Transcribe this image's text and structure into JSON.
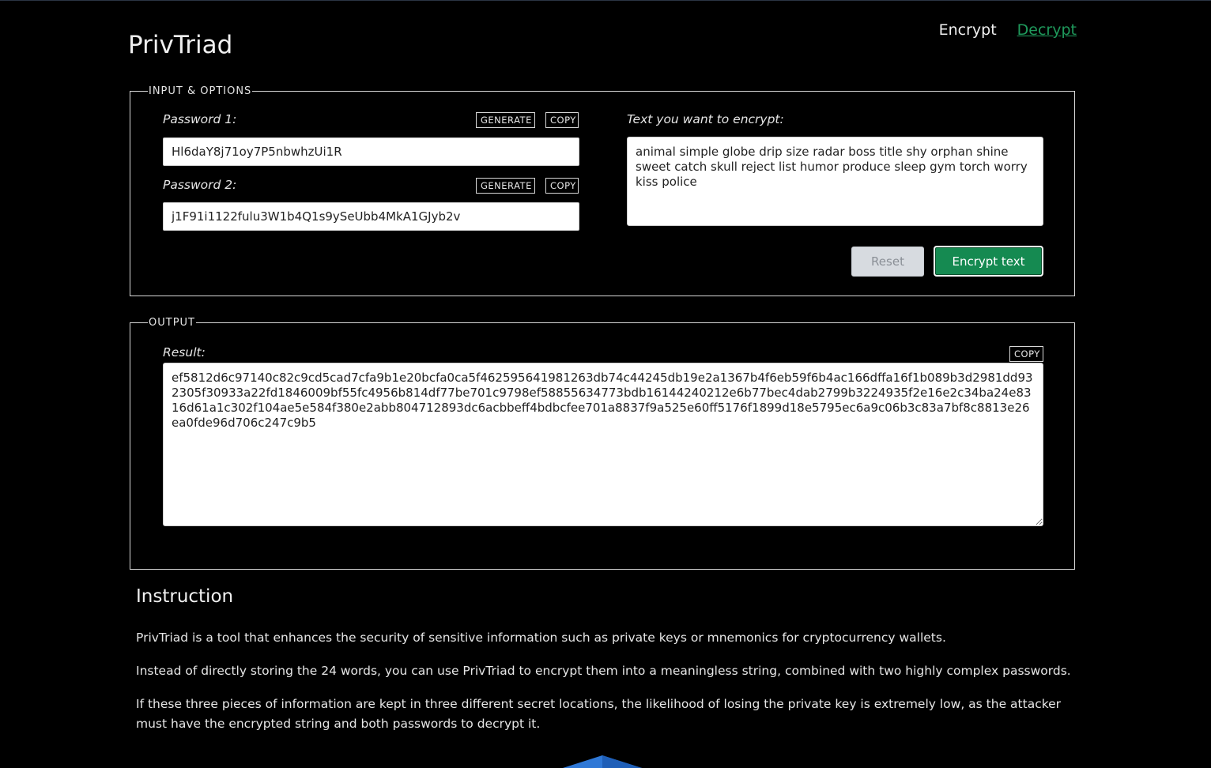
{
  "app": {
    "title": "PrivTriad"
  },
  "nav": {
    "encrypt": "Encrypt",
    "decrypt": "Decrypt"
  },
  "input_panel": {
    "legend": "INPUT & OPTIONS",
    "password1": {
      "label": "Password 1:",
      "value": "Hl6daY8j71oy7P5nbwhzUi1R",
      "generate": "GENERATE",
      "copy": "COPY"
    },
    "password2": {
      "label": "Password 2:",
      "value": "j1F91i1122fulu3W1b4Q1s9ySeUbb4MkA1GJyb2v",
      "generate": "GENERATE",
      "copy": "COPY"
    },
    "text": {
      "label": "Text you want to encrypt:",
      "value": "animal simple globe drip size radar boss title shy orphan shine sweet catch skull reject list humor produce sleep gym torch worry kiss police"
    },
    "reset": "Reset",
    "encrypt": "Encrypt text"
  },
  "output_panel": {
    "legend": "OUTPUT",
    "label": "Result:",
    "copy": "COPY",
    "value": "ef5812d6c97140c82c9cd5cad7cfa9b1e20bcfa0ca5f462595641981263db74c44245db19e2a1367b4f6eb59f6b4ac166dffa16f1b089b3d2981dd932305f30933a22fd1846009bf55fc4956b814df77be701c9798ef58855634773bdb16144240212e6b77bec4dab2799b3224935f2e16e2c34ba24e8316d61a1c302f104ae5e584f380e2abb804712893dc6acbbeff4bdbcfee701a8837f9a525e60ff5176f1899d18e5795ec6a9c06b3c83a7bf8c8813e26ea0fde96d706c247c9b5"
  },
  "instruction": {
    "title": "Instruction",
    "paragraphs": [
      "PrivTriad is a tool that enhances the security of sensitive information such as private keys or mnemonics for cryptocurrency wallets.",
      "Instead of directly storing the 24 words, you can use PrivTriad to encrypt them into a meaningless string, combined with two highly complex passwords.",
      "If these three pieces of information are kept in three different secret locations, the likelihood of losing the private key is extremely low, as the attacker must have the encrypted string and both passwords to decrypt it."
    ]
  },
  "colors": {
    "background": "#000000",
    "accent": "#158a51",
    "link_active": "#1f9a5c",
    "logo": "#2f78d6"
  },
  "icons": {
    "footer_logo": "shield-logo-icon"
  }
}
